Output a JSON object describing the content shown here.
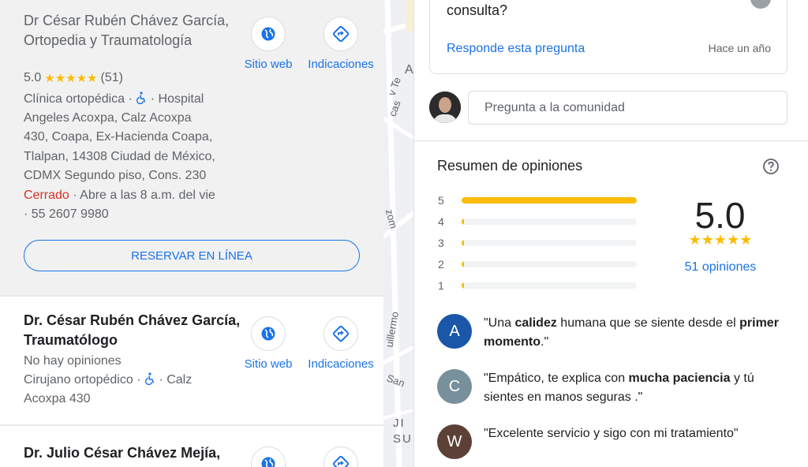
{
  "results": [
    {
      "title": "Dr César Rubén Chávez García, Ortopedia y Traumatología",
      "rating": "5.0",
      "stars": "★★★★★",
      "review_count": "(51)",
      "category": "Clínica ortopédica ·",
      "address_inline": "· Hospital",
      "address_lines": [
        "Angeles Acoxpa, Calz Acoxpa",
        "430, Coapa, Ex-Hacienda Coapa,",
        "Tlalpan, 14308 Ciudad de México,",
        "CDMX Segundo piso, Cons. 230"
      ],
      "status": "Cerrado",
      "hours": "· Abre a las 8 a.m. del vie",
      "phone": "· 55 2607 9980",
      "website_label": "Sitio web",
      "directions_label": "Indicaciones",
      "reserve_label": "RESERVAR EN LÍNEA"
    },
    {
      "title": "Dr. César Rubén Chávez García, Traumatólogo",
      "no_reviews": "No hay opiniones",
      "category": "Cirujano ortopédico ·",
      "address_inline": "· Calz",
      "address_line2": "Acoxpa 430",
      "website_label": "Sitio web",
      "directions_label": "Indicaciones"
    },
    {
      "title": "Dr. Julio César Chávez Mejía,"
    }
  ],
  "map": {
    "labels": [
      "A",
      "v Te",
      "cas",
      "zom",
      "uillermo",
      "San",
      "JI",
      "SU"
    ]
  },
  "qa": {
    "question_tail": "consulta?",
    "answer_label": "Responde esta pregunta",
    "time": "Hace un año"
  },
  "ask": {
    "placeholder": "Pregunta a la comunidad"
  },
  "summary": {
    "title": "Resumen de opiniones",
    "score": "5.0",
    "stars": "★★★★★",
    "count_label": "51 opiniones",
    "histogram": [
      {
        "label": "5",
        "fraction": 1.0
      },
      {
        "label": "4",
        "fraction": 0.0
      },
      {
        "label": "3",
        "fraction": 0.0
      },
      {
        "label": "2",
        "fraction": 0.0
      },
      {
        "label": "1",
        "fraction": 0.0
      }
    ]
  },
  "snippets": [
    {
      "initial": "A",
      "color": "#1a57a8",
      "parts": [
        "\"Una ",
        "calidez",
        " humana que se siente desde el ",
        "primer momento",
        ".\""
      ]
    },
    {
      "initial": "C",
      "color": "#78909c",
      "parts": [
        "\"Empático, te explica con ",
        "mucha paciencia",
        " y tú sientes en manos seguras .\""
      ]
    },
    {
      "initial": "W",
      "color": "#5d4037",
      "parts": [
        "\"Excelente servicio y sigo con mi tratamiento\""
      ]
    }
  ],
  "colors": {
    "accent": "#1a73e8",
    "star": "#fbbc04",
    "closed": "#d93025"
  }
}
